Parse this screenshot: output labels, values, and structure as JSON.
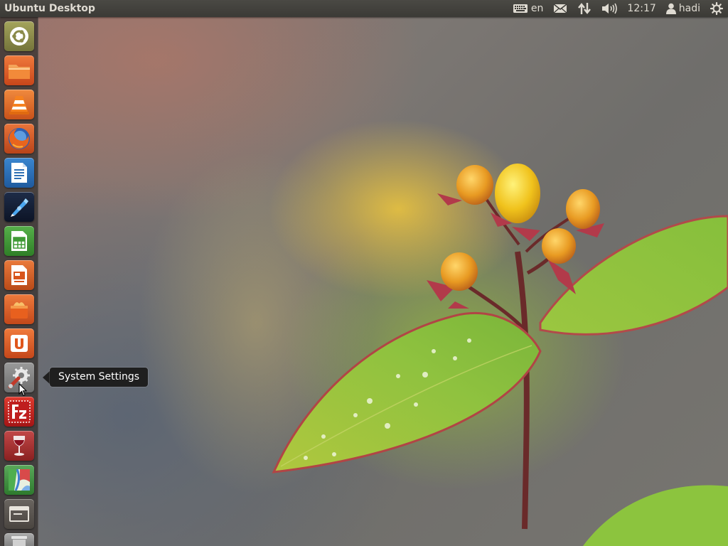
{
  "panel": {
    "title": "Ubuntu Desktop",
    "keyboard_layout": "en",
    "time": "12:17",
    "user": "hadi"
  },
  "launcher": {
    "items": [
      {
        "name": "dash-home",
        "icon": "ubuntu-logo-icon",
        "color": "#8a8a4a"
      },
      {
        "name": "files",
        "icon": "folder-icon",
        "color": "#e2591d"
      },
      {
        "name": "vlc",
        "icon": "vlc-cone-icon",
        "color": "#e0691e"
      },
      {
        "name": "firefox",
        "icon": "firefox-icon",
        "color": "#d4521c"
      },
      {
        "name": "libreoffice-writer",
        "icon": "writer-document-icon",
        "color": "#2f6fb4"
      },
      {
        "name": "ide",
        "icon": "blue-pen-icon",
        "color": "#16223a"
      },
      {
        "name": "libreoffice-calc",
        "icon": "calc-spreadsheet-icon",
        "color": "#3f9a35"
      },
      {
        "name": "libreoffice-impress",
        "icon": "impress-presentation-icon",
        "color": "#d8551c"
      },
      {
        "name": "software-app",
        "icon": "orange-box-icon",
        "color": "#df5a1e"
      },
      {
        "name": "ubuntu-software-center",
        "icon": "software-center-icon",
        "color": "#e0561c"
      },
      {
        "name": "system-settings",
        "icon": "gear-wrench-icon",
        "color": "#8a8a8a"
      },
      {
        "name": "filezilla",
        "icon": "filezilla-icon",
        "color": "#c8201e"
      },
      {
        "name": "wine",
        "icon": "wine-glass-icon",
        "color": "#b33434"
      },
      {
        "name": "maps-app",
        "icon": "map-icon",
        "color": "#3f9a3f"
      },
      {
        "name": "workspace-switcher",
        "icon": "workspace-icon",
        "color": "#5a5550"
      },
      {
        "name": "trash",
        "icon": "trash-icon",
        "color": "#8f8f8f"
      }
    ]
  },
  "tooltip": {
    "text": "System Settings"
  }
}
